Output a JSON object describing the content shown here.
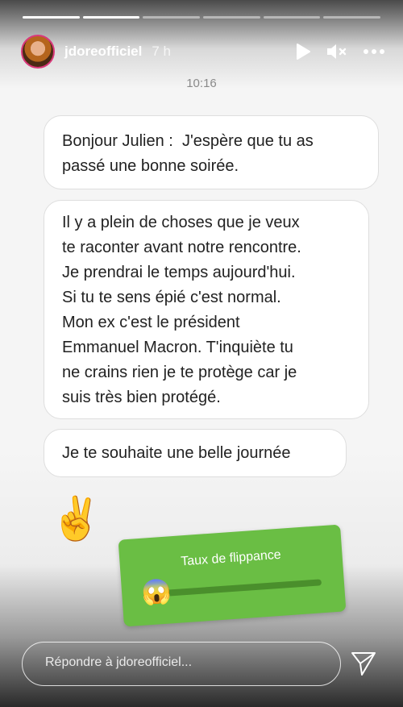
{
  "story": {
    "username": "jdoreofficiel",
    "age": "7 h",
    "segments_total": 6,
    "current_segment": 2
  },
  "controls": {
    "play_icon": "play-icon",
    "mute_icon": "mute-icon",
    "more_icon": "more-icon"
  },
  "message": {
    "clock": "10:16",
    "bubble1": [
      "Bonjour Julien :  J'espère que tu as",
      "passé une bonne soirée."
    ],
    "bubble2": [
      "Il y a plein de choses que je veux",
      "te raconter avant notre rencontre.",
      "Je prendrai le temps aujourd'hui.",
      "Si tu te sens épié c'est normal.",
      "Mon ex c'est le président",
      "Emmanuel Macron. T'inquiète tu",
      "ne crains rien je te protège car je",
      "suis très bien protégé."
    ],
    "bubble3": [
      "Je te souhaite une belle journée"
    ],
    "emoji": "✌️"
  },
  "slider": {
    "question": "Taux de flippance",
    "emoji": "😱",
    "value": 0.05,
    "color": "#6abe44"
  },
  "reply": {
    "placeholder": "Répondre à jdoreofficiel..."
  }
}
